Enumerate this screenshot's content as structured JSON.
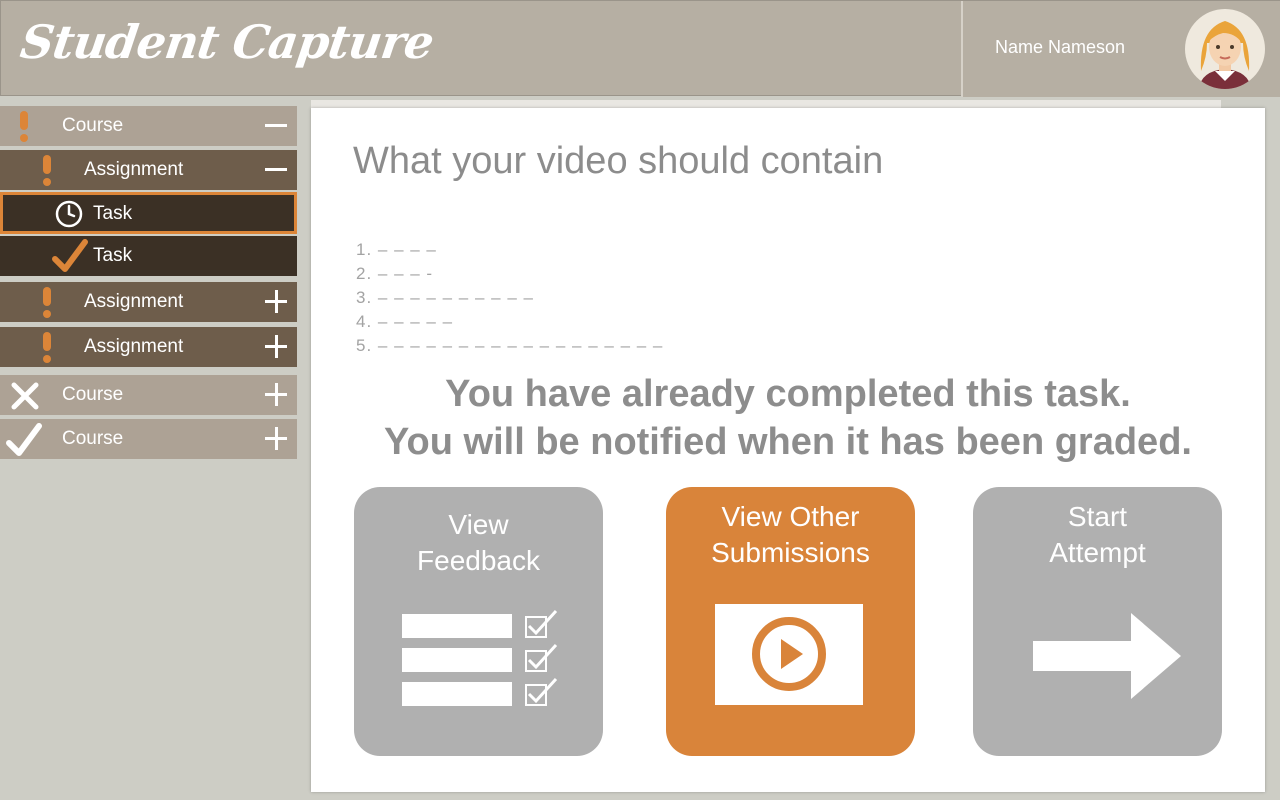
{
  "app": {
    "title": "Student Capture"
  },
  "user": {
    "name": "Name Nameson"
  },
  "sidebar": {
    "items": [
      {
        "label": "Course",
        "status": "pending",
        "toggle": "collapse"
      },
      {
        "label": "Assignment",
        "status": "pending",
        "toggle": "collapse"
      },
      {
        "label": "Task",
        "status": "in-progress",
        "selected": true
      },
      {
        "label": "Task",
        "status": "completed"
      },
      {
        "label": "Assignment",
        "status": "pending",
        "toggle": "expand"
      },
      {
        "label": "Assignment",
        "status": "pending",
        "toggle": "expand"
      },
      {
        "label": "Course",
        "status": "failed",
        "toggle": "expand"
      },
      {
        "label": "Course",
        "status": "completed",
        "toggle": "expand"
      }
    ]
  },
  "main": {
    "title": "What your video should contain",
    "list": [
      "1. – – – –",
      "2. – – – -",
      "3. – – – – – – – – – –",
      "4. – – – – –",
      "5. – – – – – – – – – – – – – – – – – –"
    ],
    "message_line1": "You have already completed this task.",
    "message_line2": "You will be notified when it has been graded.",
    "tiles": {
      "feedback": {
        "line1": "View",
        "line2": "Feedback"
      },
      "submissions": {
        "line1": "View Other",
        "line2": "Submissions"
      },
      "attempt": {
        "line1": "Start",
        "line2": "Attempt"
      }
    }
  },
  "colors": {
    "accent": "#dc8538",
    "header": "#b6afa3",
    "course_row": "#ada295",
    "assignment_row": "#6e5d4b",
    "task_row": "#3b3025",
    "tile_gray": "#b0b0b0",
    "tile_orange": "#d9843a"
  },
  "icons": {
    "pending": "exclamation-icon",
    "in_progress": "clock-icon",
    "completed": "checkmark-icon",
    "failed": "x-icon",
    "feedback": "checklist-icon",
    "submissions": "video-play-icon",
    "attempt": "arrow-right-icon"
  }
}
